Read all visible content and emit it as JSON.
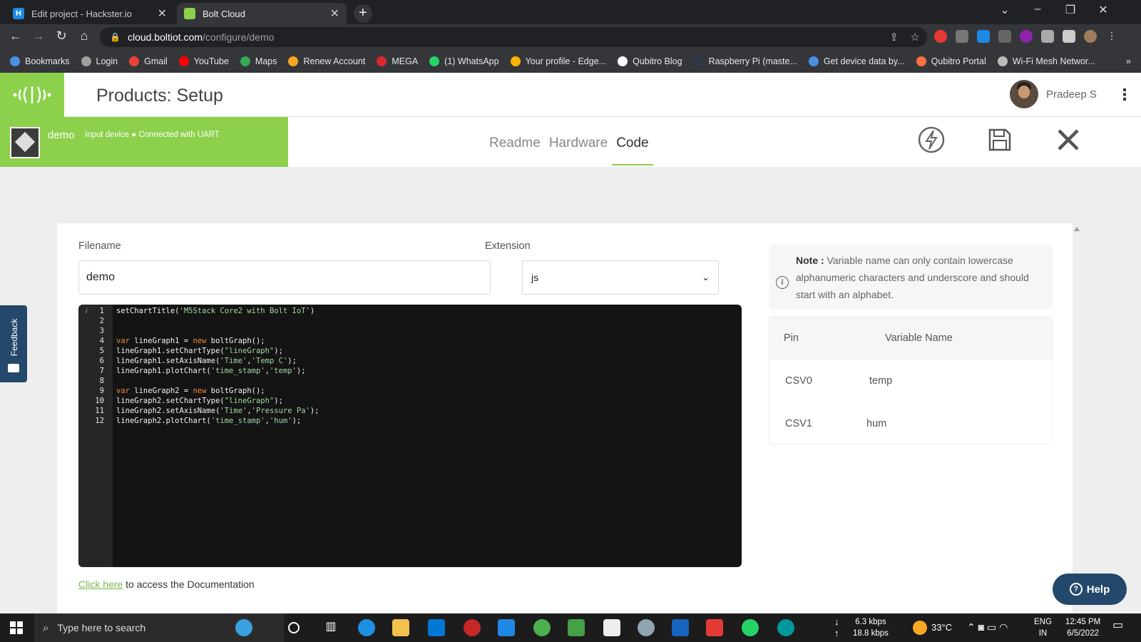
{
  "browser": {
    "tabs": [
      {
        "title": "Edit project - Hackster.io",
        "favicon_color": "#1e88e5",
        "favicon_letter": "H"
      },
      {
        "title": "Bolt Cloud",
        "favicon_color": "#8cd04c",
        "favicon_letter": ""
      }
    ],
    "url_host": "cloud.boltiot.com",
    "url_path": "/configure/demo",
    "bookmarks": [
      {
        "label": "Bookmarks",
        "color": "#4a90e2"
      },
      {
        "label": "Login",
        "color": "#9e9e9e"
      },
      {
        "label": "Gmail",
        "color": "#ea4335"
      },
      {
        "label": "YouTube",
        "color": "#ff0000"
      },
      {
        "label": "Maps",
        "color": "#34a853"
      },
      {
        "label": "Renew Account",
        "color": "#f5a623"
      },
      {
        "label": "MEGA",
        "color": "#d9272e"
      },
      {
        "label": "(1) WhatsApp",
        "color": "#25d366"
      },
      {
        "label": "Your profile - Edge...",
        "color": "#ffb300"
      },
      {
        "label": "Qubitro Blog",
        "color": "#ffffff"
      },
      {
        "label": "Raspberry Pi (maste...",
        "color": "#2b3a4a"
      },
      {
        "label": "Get device data by...",
        "color": "#4a90e2"
      },
      {
        "label": "Qubitro Portal",
        "color": "#ff7043"
      },
      {
        "label": "Wi-Fi Mesh Networ...",
        "color": "#bbbbbb"
      }
    ]
  },
  "app": {
    "title": "Products: Setup",
    "user": "Pradeep S",
    "device": {
      "name": "demo",
      "status": "Input device ● Connected with UART"
    },
    "tabs": [
      "Readme",
      "Hardware",
      "Code"
    ],
    "active_tab": "Code"
  },
  "form": {
    "filename_label": "Filename",
    "filename_value": "demo",
    "extension_label": "Extension",
    "extension_value": "js"
  },
  "code_lines": [
    {
      "n": "1",
      "text": "setChartTitle('M5Stack Core2 with Bolt IoT')"
    },
    {
      "n": "2",
      "text": ""
    },
    {
      "n": "3",
      "text": ""
    },
    {
      "n": "4",
      "text": "var lineGraph1 = new boltGraph();"
    },
    {
      "n": "5",
      "text": "lineGraph1.setChartType(\"lineGraph\");"
    },
    {
      "n": "6",
      "text": "lineGraph1.setAxisName('Time','Temp C');"
    },
    {
      "n": "7",
      "text": "lineGraph1.plotChart('time_stamp','temp');"
    },
    {
      "n": "8",
      "text": ""
    },
    {
      "n": "9",
      "text": "var lineGraph2 = new boltGraph();"
    },
    {
      "n": "10",
      "text": "lineGraph2.setChartType(\"lineGraph\");"
    },
    {
      "n": "11",
      "text": "lineGraph2.setAxisName('Time','Pressure Pa');"
    },
    {
      "n": "12",
      "text": "lineGraph2.plotChart('time_stamp','hum');"
    }
  ],
  "doc_link": {
    "link_text": "Click here",
    "rest": " to access the Documentation"
  },
  "note": {
    "bold": "Note :",
    "text": " Variable name can only contain lowercase alphanumeric characters and underscore and should start with an alphabet."
  },
  "pin_table": {
    "headers": [
      "Pin",
      "Variable Name"
    ],
    "rows": [
      {
        "pin": "CSV0",
        "var": "temp"
      },
      {
        "pin": "CSV1",
        "var": "hum"
      }
    ]
  },
  "feedback_label": "Feedback",
  "help_label": "Help",
  "taskbar": {
    "search_placeholder": "Type here to search",
    "net_down": "6.3 kbps",
    "net_up": "18.8 kbps",
    "weather": "33°C",
    "lang": "ENG",
    "region": "IN",
    "time": "12:45 PM",
    "date": "6/5/2022"
  },
  "colors": {
    "brand_green": "#8cd04c",
    "help_blue": "#23486b",
    "editor_bg": "#141414"
  }
}
